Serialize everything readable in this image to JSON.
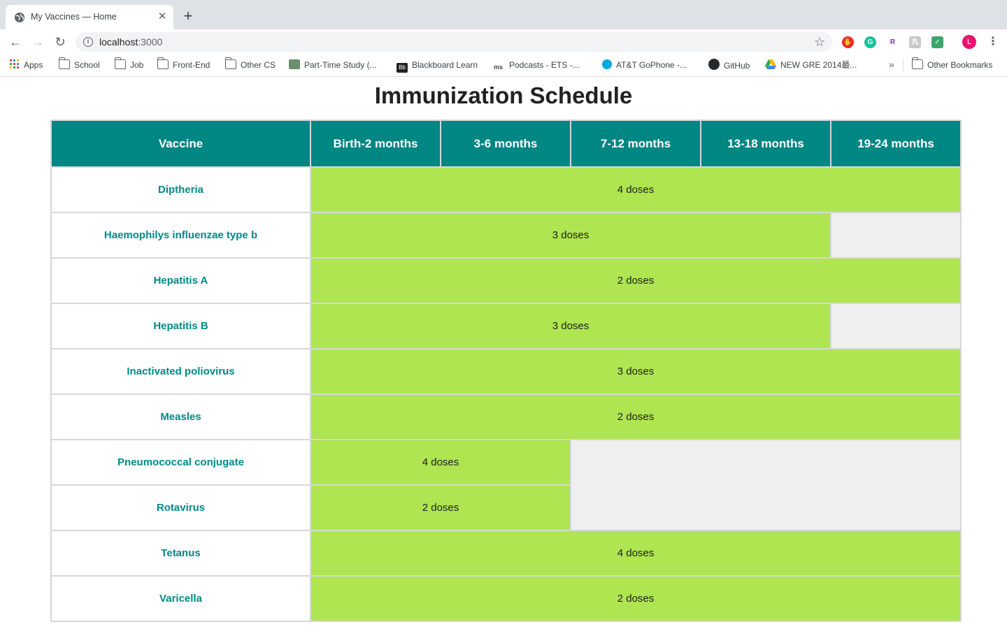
{
  "browser": {
    "tab_title": "My Vaccines — Home",
    "url_host": "localhost",
    "url_port": ":3000",
    "avatar_letter": "L",
    "bookmarks": {
      "apps": "Apps",
      "school": "School",
      "job": "Job",
      "frontend": "Front-End",
      "othercs": "Other CS",
      "parttime": "Part-Time Study (...",
      "blackboard": "Blackboard Learn",
      "podcasts": "Podcasts - ETS -...",
      "att": "AT&T GoPhone -...",
      "github": "GitHub",
      "gre": "NEW GRE 2014最...",
      "other": "Other Bookmarks"
    }
  },
  "page": {
    "title": "Immunization Schedule"
  },
  "table": {
    "headers": [
      "Vaccine",
      "Birth-2 months",
      "3-6 months",
      "7-12 months",
      "13-18 months",
      "19-24 months"
    ],
    "rows": [
      {
        "vaccine": "Diptheria",
        "doses": "4 doses"
      },
      {
        "vaccine": "Haemophilys influenzae type b",
        "doses": "3 doses"
      },
      {
        "vaccine": "Hepatitis A",
        "doses": "2 doses"
      },
      {
        "vaccine": "Hepatitis B",
        "doses": "3 doses"
      },
      {
        "vaccine": "Inactivated poliovirus",
        "doses": "3 doses"
      },
      {
        "vaccine": "Measles",
        "doses": "2 doses"
      },
      {
        "vaccine": "Pneumococcal conjugate",
        "doses": "4 doses"
      },
      {
        "vaccine": "Rotavirus",
        "doses": "2 doses"
      },
      {
        "vaccine": "Tetanus",
        "doses": "4 doses"
      },
      {
        "vaccine": "Varicella",
        "doses": "2 doses"
      }
    ]
  },
  "colors": {
    "header_bg": "#008683",
    "vaccine_text": "#008a86",
    "dose_bg": "#aee551",
    "empty_bg": "#efefef"
  }
}
